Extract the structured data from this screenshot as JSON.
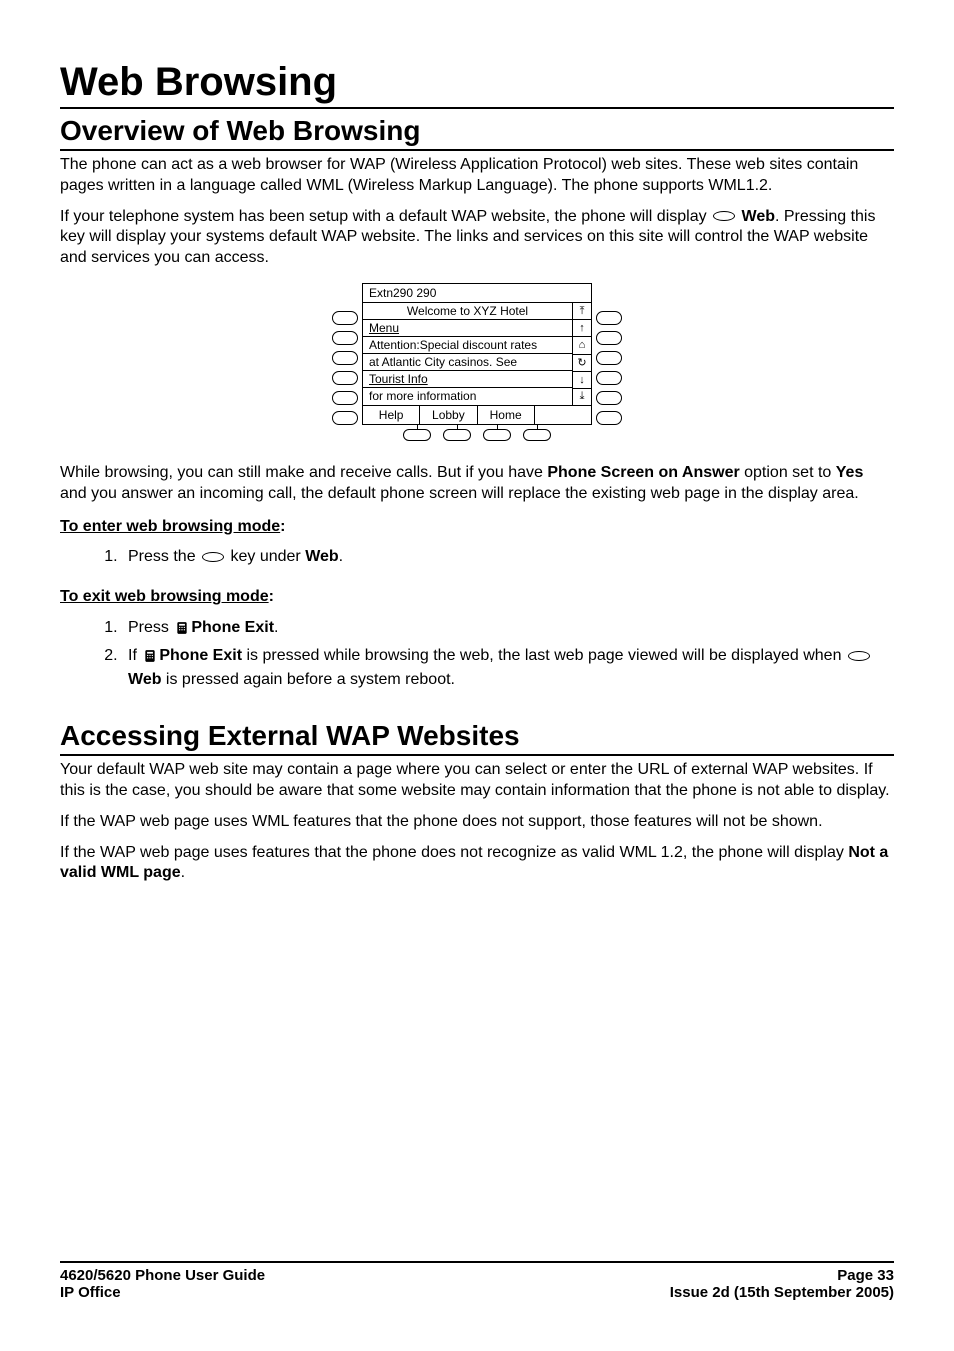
{
  "title": "Web Browsing",
  "section1": {
    "heading": "Overview of Web Browsing",
    "p1": "The phone can act as a web browser for WAP (Wireless Application Protocol) web sites. These web sites contain pages written in a language called WML (Wireless Markup Language). The phone supports WML1.2.",
    "p2a": "If your telephone system has been setup with a default WAP website, the phone will display ",
    "p2_web": "Web",
    "p2b": ". Pressing this key will display your systems default WAP website. The links and services on this site will control the WAP website and services you can access.",
    "p3a": "While browsing, you can still make and receive calls. But if you have ",
    "p3_opt": "Phone Screen on Answer",
    "p3b": " option set to ",
    "p3_yes": "Yes",
    "p3c": " and you answer an incoming call, the default phone screen will replace the existing web page in the display area.",
    "enter_heading": "To enter web browsing mode",
    "enter_colon": ":",
    "enter_step_a": "Press the ",
    "enter_step_b": " key under ",
    "enter_step_web": "Web",
    "enter_step_c": ".",
    "exit_heading": "To exit web browsing mode",
    "exit_colon": ":",
    "exit_step1_a": "Press ",
    "exit_step1_b": "Phone Exit",
    "exit_step1_c": ".",
    "exit_step2_a": "If ",
    "exit_step2_b": "Phone Exit",
    "exit_step2_c": " is pressed while browsing the web, the last web page viewed will be displayed when ",
    "exit_step2_web": "Web",
    "exit_step2_d": " is pressed again before a system reboot."
  },
  "figure": {
    "title": "Extn290 290",
    "lines": [
      "Welcome to XYZ Hotel",
      "Menu",
      "Attention:Special discount rates",
      "at Atlantic City casinos. See",
      "Tourist Info",
      "for more information"
    ],
    "softkeys": [
      "Help",
      "Lobby",
      "Home"
    ],
    "scroll_icons": [
      "⤒",
      "↑",
      "⌂",
      "↻",
      "↓",
      "⤓"
    ]
  },
  "section2": {
    "heading": "Accessing External WAP Websites",
    "p1": "Your default WAP web site may contain a page where you can select or enter the URL of external WAP websites. If this is the case, you should be aware that some website may contain information that the phone is not able to display.",
    "p2": "If the WAP web page uses WML features that the phone does not support, those features will not be shown.",
    "p3a": "If the WAP web page uses features that the phone does not recognize as valid WML 1.2, the phone will display ",
    "p3_bold": "Not a valid WML page",
    "p3b": "."
  },
  "footer": {
    "left1": "4620/5620 Phone User Guide",
    "left2": "IP Office",
    "right1": "Page 33",
    "right2": "Issue 2d (15th September 2005)"
  }
}
